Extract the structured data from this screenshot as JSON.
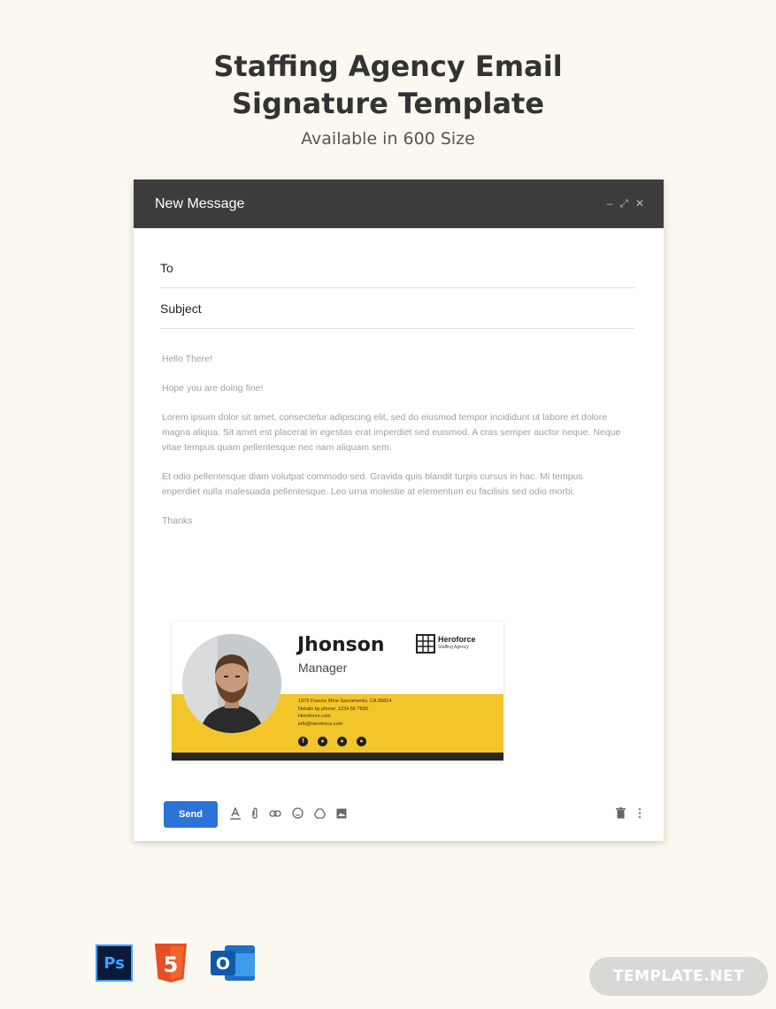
{
  "page": {
    "title_line1": "Staffing Agency Email",
    "title_line2": "Signature Template",
    "subtitle": "Available in 600 Size"
  },
  "compose": {
    "header_title": "New Message",
    "controls": [
      "–",
      "⤢",
      "✕"
    ],
    "to_label": "To",
    "subject_label": "Subject",
    "body": {
      "greeting": "Hello There!",
      "line2": "Hope you are doing fine!",
      "paragraph1": "Lorem ipsum dolor sit amet, consectetur adipiscing elit, sed do eiusmod tempor incididunt ut labore et dolore magna aliqua. Sit amet est placerat in egestas erat imperdiet sed euismod. A cras semper auctor neque. Neque vitae tempus quam pellentesque nec nam aliquam sem.",
      "paragraph2": "Et odio pellentesque diam volutpat commodo sed. Gravida quis blandit turpis cursus in hac. Mi tempus imperdiet nulla malesuada pellentesque. Leo urna molestie at elementum eu facilisis sed odio morbi.",
      "closing": "Thanks"
    },
    "signature": {
      "name": "Jhonson",
      "title": "Manager",
      "logo_name": "Heroforce",
      "logo_sub": "Staffing Agency",
      "address": "1975 Francis Mine Sacramento, CA 95814",
      "phone": "Details by phone: 1234 56 7890",
      "website": "Heroforce.com",
      "email": "info@heroforce.com",
      "social_icons": [
        "facebook-icon",
        "twitter-icon",
        "linkedin-icon",
        "pinterest-icon"
      ],
      "colors": {
        "accent": "#f2c52a",
        "dark": "#2a2620"
      }
    },
    "toolbar": {
      "send_label": "Send",
      "tools": [
        "format-text-icon",
        "attach-icon",
        "link-icon",
        "emoji-icon",
        "drive-icon",
        "photo-icon"
      ],
      "right": [
        "trash-icon",
        "more-icon"
      ]
    }
  },
  "footer": {
    "app_icons": [
      "photoshop-icon",
      "html5-icon",
      "outlook-icon"
    ],
    "ps_label": "Ps",
    "html5_label": "5",
    "outlook_label": "O",
    "badge": "TEMPLATE.NET"
  },
  "colors": {
    "background": "#fbf8ef",
    "header": "#3d3d3d",
    "send": "#2a73d9"
  }
}
